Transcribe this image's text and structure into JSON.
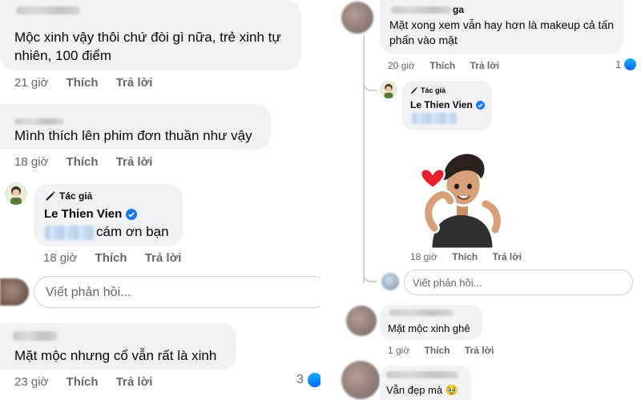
{
  "left": {
    "comments": [
      {
        "text": "Mộc xinh vậy thôi chứ đòi gì nữa, trẻ xinh tự nhiên, 100 điểm",
        "line1": "Mộc xinh vậy thôi chứ đòi gì nữa, trẻ xinh tự",
        "line2": "nhiên, 100 điểm",
        "time": "21 giờ",
        "like": "Thích",
        "reply": "Trả lời"
      },
      {
        "text": "Mình thích lên phim đơn thuần như vậy",
        "time": "18 giờ",
        "like": "Thích",
        "reply": "Trả lời"
      },
      {
        "author_tag": "Tác giả",
        "author_name": "Le Thien Vien",
        "text": "cám ơn bạn",
        "time": "18 giờ",
        "like": "Thích",
        "reply": "Trả lời"
      },
      {
        "text": "Mặt mộc nhưng cổ vẫn rất là xinh",
        "time": "23 giờ",
        "like": "Thích",
        "reply": "Trả lời",
        "reaction_count": "3"
      }
    ],
    "reply_input": {
      "placeholder": "Viết phản hồi..."
    }
  },
  "right": {
    "comments": [
      {
        "name_suffix": "ga",
        "line1": "Mặt xong xem vẫn hay hơn là makeup cả tấn",
        "line2": "phấn vào mặt",
        "time": "20 giờ",
        "like": "Thích",
        "reply": "Trả lời",
        "reaction_count": "1"
      },
      {
        "author_tag": "Tác giả",
        "author_name": "Le Thien Vien",
        "time": "18 giờ",
        "like": "Thích",
        "reply": "Trả lời",
        "sticker": "heart-hands-avatar-sticker"
      },
      {
        "text": "Mặt mộc xinh ghê",
        "time": "1 giờ",
        "like": "Thích",
        "reply": "Trả lời"
      },
      {
        "text": "Vẫn đẹp mà 🥹"
      }
    ],
    "reply_input": {
      "placeholder": "Viết phản hồi..."
    }
  },
  "icons": {
    "author_tag": "pencil-icon",
    "verified": "verified-badge-icon",
    "like": "like-reaction-icon"
  },
  "colors": {
    "bubble": "#f0f2f5",
    "meta": "#65676b",
    "verified": "#1877f2",
    "like": "#0866ff"
  }
}
